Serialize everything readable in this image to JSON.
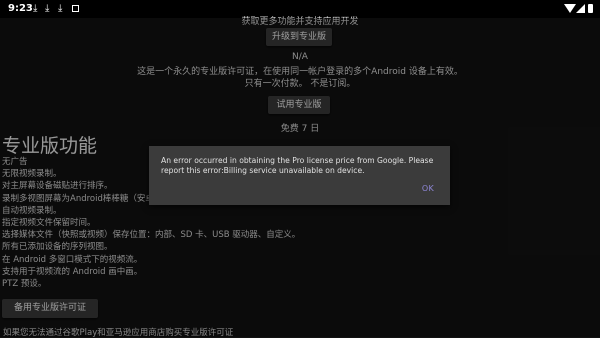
{
  "statusbar": {
    "time": "9:23",
    "icons": [
      "download-icon",
      "download-icon",
      "download-icon",
      "square-icon",
      "wifi-icon",
      "cell-signal-icon",
      "battery-icon"
    ]
  },
  "top_text": "获取更多功能并支持应用开发",
  "upgrade_button": "升级到专业版",
  "price": "N/A",
  "license_desc_line1": "这是一个永久的专业版许可证，在使用同一帐户登录的多个Android 设备上有效。",
  "license_desc_line2": "只有一次付款。 不是订阅。",
  "trial_button": "试用专业版",
  "trial_days": "免费 7 日",
  "pro_title": "专业版功能",
  "features": [
    "无广告",
    "无限视频录制。",
    "对主屏幕设备磁贴进行排序。",
    "录制多视图屏幕为Android棒棒糖（安卓5.0",
    "自动视频录制。",
    "指定视频文件保留时间。",
    "选择媒体文件（快照或视频）保存位置：内部、SD 卡、USB 驱动器、自定义。",
    "所有已添加设备的序列视图。",
    "在 Android 多窗口模式下的视频流。",
    "支持用于视频流的 Android 画中画。",
    "PTZ 预设。"
  ],
  "backup_license_button": "备用专业版许可证",
  "footer_text": "如果您无法通过谷歌Play和亚马逊应用商店购买专业版许可证",
  "dialog": {
    "message": "An error occurred in obtaining the Pro license price from Google.  Please report this error:Billing service unavailable on device.",
    "ok_label": "OK"
  }
}
